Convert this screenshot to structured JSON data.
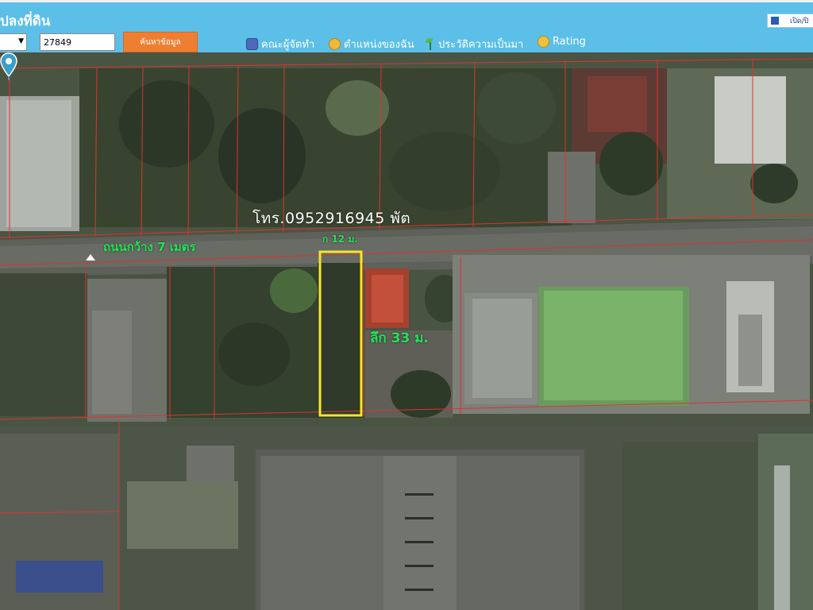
{
  "header": {
    "title": "ปลงที่ดิน",
    "parcel_value": "27849",
    "search_label": "ค้นหาข้อมูล",
    "nav": [
      {
        "label": "คณะผู้จัดทำ",
        "icon": "team-icon"
      },
      {
        "label": "ตำแหน่งของฉัน",
        "icon": "my-location-icon"
      },
      {
        "label": "ประวัติความเป็นมา",
        "icon": "plant-icon"
      },
      {
        "label": "Rating",
        "icon": "rating-icon"
      }
    ],
    "corner_label": "เปิด/ปิ"
  },
  "map": {
    "phone": "โทร.0952916945   พัต",
    "road_label": "ถนนกว้าง 7 เมตร",
    "width_label": "ก 12 ม.",
    "depth_label": "ลึก 33 ม.",
    "parcel_outline_color": "#f5e62c",
    "boundary_color": "#d9352e",
    "label_color": "#28e05a",
    "header_color": "#5bbfe8",
    "button_color": "#ee7f32"
  }
}
